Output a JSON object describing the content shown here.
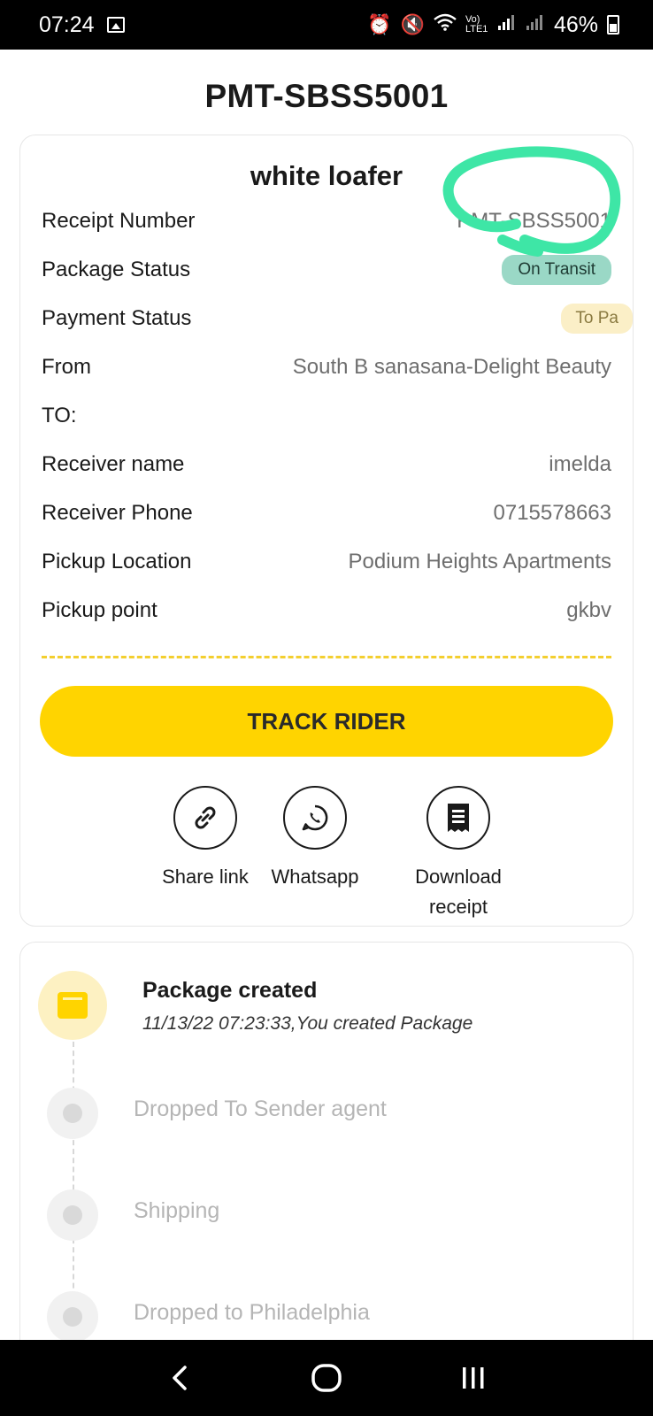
{
  "status_bar": {
    "time": "07:24",
    "battery": "46%",
    "network": "Vo) LTE1"
  },
  "page": {
    "title": "PMT-SBSS5001"
  },
  "details": {
    "item_name": "white loafer",
    "rows": [
      {
        "label": "Receipt Number",
        "value": "PMT-SBSS5001"
      },
      {
        "label": "Package Status",
        "value": "On Transit"
      },
      {
        "label": "Payment Status",
        "value": "To Pa"
      },
      {
        "label": "From",
        "value": "South B sanasana-Delight Beauty"
      },
      {
        "label": "TO:",
        "value": ""
      },
      {
        "label": "Receiver name",
        "value": "imelda"
      },
      {
        "label": "Receiver Phone",
        "value": "0715578663"
      },
      {
        "label": "Pickup Location",
        "value": "Podium Heights Apartments"
      },
      {
        "label": "Pickup point",
        "value": "gkbv"
      }
    ],
    "track_button": "TRACK RIDER",
    "actions": [
      {
        "label": "Share link",
        "icon": "link-icon"
      },
      {
        "label": "Whatsapp",
        "icon": "whatsapp-icon"
      },
      {
        "label": "Download receipt",
        "icon": "receipt-icon"
      }
    ]
  },
  "timeline": [
    {
      "title": "Package created",
      "subtitle": "11/13/22 07:23:33,You created Package",
      "done": true
    },
    {
      "title": "Dropped To Sender agent",
      "done": false
    },
    {
      "title": "Shipping",
      "done": false
    },
    {
      "title": "Dropped to Philadelphia",
      "done": false
    }
  ],
  "colors": {
    "accent": "#ffd400",
    "transit_badge": "#9ad8c6",
    "payment_badge": "#fbefc7",
    "annotation": "#3ee6a6"
  }
}
